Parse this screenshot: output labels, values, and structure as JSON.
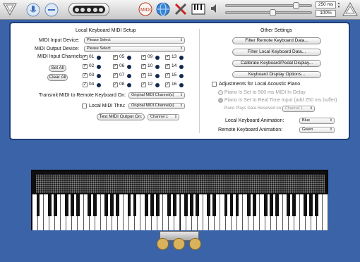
{
  "toolbar": {
    "interval": "250 ms",
    "zoom": "100%"
  },
  "panel": {
    "left_title": "Local Keyboard MIDI Setup",
    "input_device_label": "MIDI Input Device:",
    "input_device_value": "Please Select",
    "output_device_label": "MIDI Output Device:",
    "output_device_value": "Please Select",
    "channels_label": "MIDI Input Channels:",
    "set_all": "Set All",
    "clear_all": "Clear All",
    "channels": [
      "01",
      "02",
      "03",
      "04",
      "05",
      "06",
      "07",
      "08",
      "09",
      "10",
      "11",
      "12",
      "13",
      "14",
      "15",
      "16"
    ],
    "transmit_label": "Transmit MIDI to Remote Keyboard On:",
    "transmit_value": "Original MIDI Channel(s)",
    "thru_label": "Local MIDI Thru:",
    "thru_value": "Original MIDI Channel(s)",
    "test_button": "Test MIDI Output On:",
    "test_value": "Channel 1",
    "right_title": "Other Settings",
    "filter_remote": "Filter Remote Keyboard Data...",
    "filter_local": "Filter Local Keyboard Data...",
    "calibrate": "Calibrate Keyboard/Pedal Display...",
    "display_options": "Keyboard Display Options...",
    "adjust_label": "Adjustments for Local Acoustic Piano",
    "radio_delay": "Piano Is Set to 500 ms MIDI In Delay",
    "radio_realtime": "Piano Is Set to Real Time Input (add 250 ms buffer)",
    "plays_label": "Piano Plays Data Received on:",
    "plays_value": "Channel 1",
    "local_anim_label": "Local Keyboard Animation:",
    "local_anim_value": "Blue",
    "remote_anim_label": "Remote Keyboard Animation:",
    "remote_anim_value": "Green"
  }
}
